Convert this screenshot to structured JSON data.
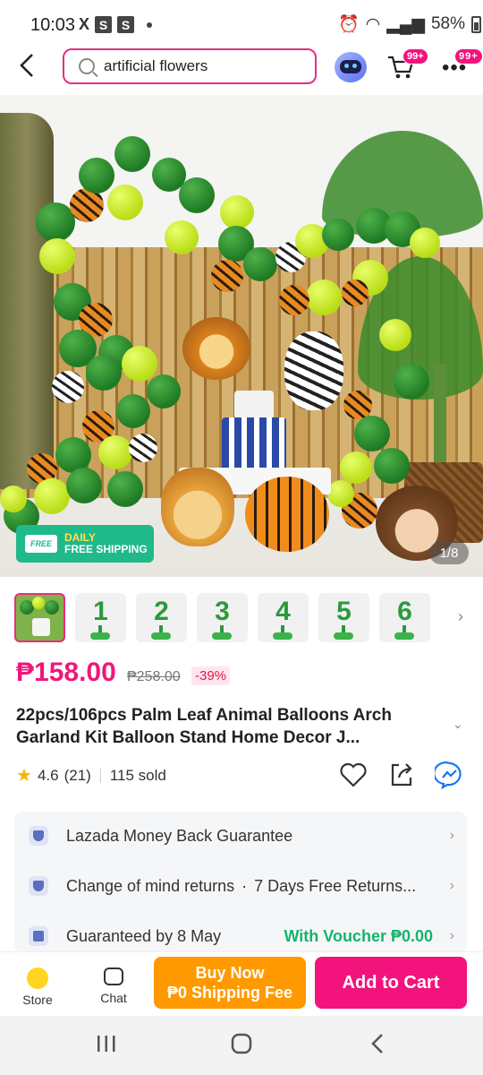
{
  "status_bar": {
    "time": "10:03",
    "left_icons": [
      "X",
      "S",
      "S"
    ],
    "battery": "58%"
  },
  "header": {
    "search_value": "artificial flowers",
    "cart_badge": "99+",
    "more_badge": "99+"
  },
  "hero": {
    "shipping_top": "DAILY",
    "shipping_bottom": "FREE SHIPPING",
    "free_tag": "FREE",
    "image_counter": "1/8"
  },
  "thumbnails": [
    "",
    "1",
    "2",
    "3",
    "4",
    "5",
    "6"
  ],
  "product": {
    "price": "₱158.00",
    "original_price": "₱258.00",
    "discount": "-39%",
    "title": "22pcs/106pcs Palm Leaf Animal Balloons Arch Garland Kit Balloon Stand Home Decor J...",
    "rating": "4.6",
    "reviews": "(21)",
    "sold": "115 sold"
  },
  "guarantees": {
    "money_back": "Lazada Money Back Guarantee",
    "returns": "Change of mind returns",
    "returns_detail": "7 Days Free Returns...",
    "delivery": "Guaranteed by 8 May",
    "voucher": "With Voucher ₱0.00"
  },
  "bottom_bar": {
    "store_label": "Store",
    "chat_label": "Chat",
    "buy_now_line1": "Buy Now",
    "buy_now_line2": "₱0 Shipping Fee",
    "add_to_cart": "Add to Cart"
  },
  "colors": {
    "brand_pink": "#f2137c",
    "buy_now_orange": "#ff9900",
    "shipping_green": "#1fb98a"
  }
}
